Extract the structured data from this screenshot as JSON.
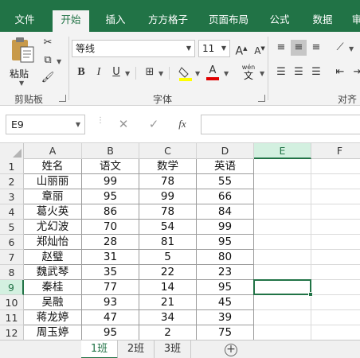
{
  "tabs": [
    {
      "label": "文件"
    },
    {
      "label": "开始"
    },
    {
      "label": "插入"
    },
    {
      "label": "方方格子"
    },
    {
      "label": "页面布局"
    },
    {
      "label": "公式"
    },
    {
      "label": "数据"
    },
    {
      "label": "审"
    }
  ],
  "ribbon": {
    "clipboard": {
      "label": "剪贴板",
      "paste_label": "粘贴"
    },
    "font": {
      "label": "字体",
      "font_name": "等线",
      "font_size": "11",
      "bold": "B",
      "italic": "I",
      "underline": "U",
      "grow": "A",
      "shrink": "A",
      "phonetic": "wén"
    },
    "alignment": {
      "label": "对齐方"
    }
  },
  "formula_bar": {
    "name_box": "E9",
    "fx": "fx",
    "formula": ""
  },
  "grid": {
    "columns": [
      "A",
      "B",
      "C",
      "D",
      "E",
      "F"
    ],
    "selected_column": "E",
    "selected_row": "9",
    "rows": [
      {
        "num": "1",
        "cells": [
          "姓名",
          "语文",
          "数学",
          "英语"
        ]
      },
      {
        "num": "2",
        "cells": [
          "山丽丽",
          "99",
          "78",
          "55"
        ]
      },
      {
        "num": "3",
        "cells": [
          "章丽",
          "95",
          "99",
          "66"
        ]
      },
      {
        "num": "4",
        "cells": [
          "葛火英",
          "86",
          "78",
          "84"
        ]
      },
      {
        "num": "5",
        "cells": [
          "尤幻波",
          "70",
          "54",
          "99"
        ]
      },
      {
        "num": "6",
        "cells": [
          "郑灿怡",
          "28",
          "81",
          "95"
        ]
      },
      {
        "num": "7",
        "cells": [
          "赵璧",
          "31",
          "5",
          "80"
        ]
      },
      {
        "num": "8",
        "cells": [
          "魏武琴",
          "35",
          "22",
          "23"
        ]
      },
      {
        "num": "9",
        "cells": [
          "秦桂",
          "77",
          "14",
          "95"
        ]
      },
      {
        "num": "10",
        "cells": [
          "吴融",
          "93",
          "21",
          "45"
        ]
      },
      {
        "num": "11",
        "cells": [
          "蒋龙婷",
          "47",
          "34",
          "39"
        ]
      },
      {
        "num": "12",
        "cells": [
          "周玉婷",
          "95",
          "2",
          "75"
        ]
      }
    ]
  },
  "sheets": [
    {
      "label": "1班"
    },
    {
      "label": "2班"
    },
    {
      "label": "3班"
    }
  ],
  "colors": {
    "accent": "#217346",
    "ribbon_bg": "#f3f3f3"
  }
}
